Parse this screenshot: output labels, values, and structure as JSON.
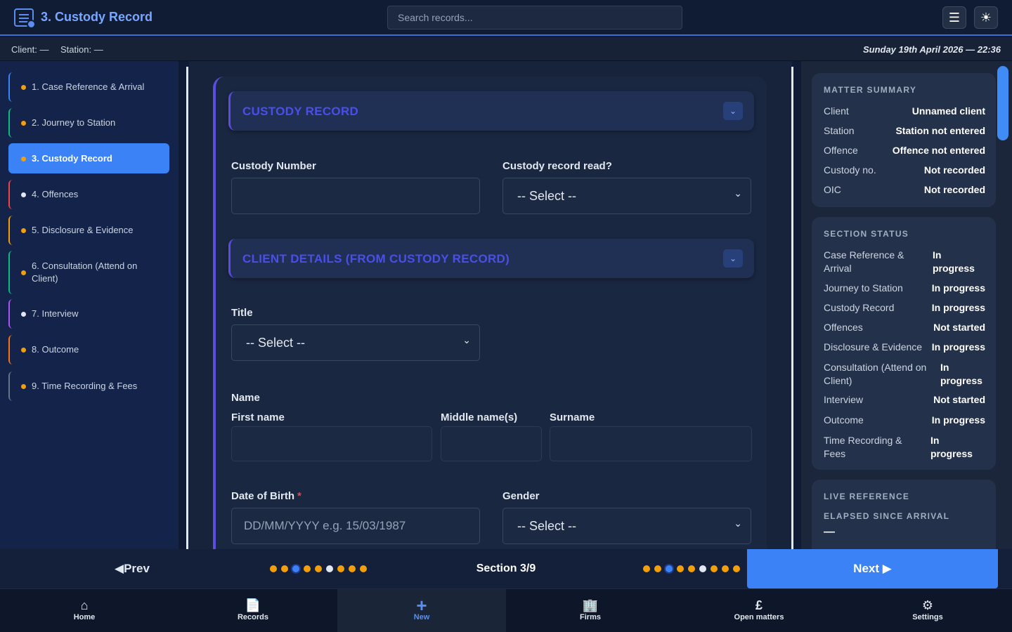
{
  "header": {
    "title": "3. Custody Record",
    "search_placeholder": "Search records...",
    "menu_icon": "hamburger-icon",
    "theme_icon": "sun-icon"
  },
  "subheader": {
    "client": "Client: —",
    "station": "Station: —",
    "datetime": "Sunday 19th April 2026 — 22:36"
  },
  "sidebar": {
    "items": [
      {
        "label": "1. Case Reference & Arrival",
        "color": "#3b82f6",
        "status": "in-progress"
      },
      {
        "label": "2. Journey to Station",
        "color": "#10b981",
        "status": "in-progress"
      },
      {
        "label": "3. Custody Record",
        "color": "#3b82f6",
        "status": "in-progress",
        "active": true
      },
      {
        "label": "4. Offences",
        "color": "#ef4444",
        "status": "not-started"
      },
      {
        "label": "5. Disclosure & Evidence",
        "color": "#f59e0b",
        "status": "in-progress"
      },
      {
        "label": "6. Consultation (Attend on Client)",
        "color": "#10b981",
        "status": "in-progress"
      },
      {
        "label": "7. Interview",
        "color": "#a855f7",
        "status": "not-started"
      },
      {
        "label": "8. Outcome",
        "color": "#f97316",
        "status": "in-progress"
      },
      {
        "label": "9. Time Recording & Fees",
        "color": "#64748b",
        "status": "in-progress"
      }
    ]
  },
  "form": {
    "section1_title": "CUSTODY RECORD",
    "custody_number_label": "Custody Number",
    "custody_number_value": "",
    "custody_read_label": "Custody record read?",
    "custody_read_value": "-- Select --",
    "section2_title": "CLIENT DETAILS (FROM CUSTODY RECORD)",
    "title_label": "Title",
    "title_value": "-- Select --",
    "name_label": "Name",
    "first_name_label": "First name",
    "middle_name_label": "Middle name(s)",
    "surname_label": "Surname",
    "dob_label": "Date of Birth",
    "dob_required": "*",
    "dob_placeholder": "DD/MM/YYYY e.g. 15/03/1987",
    "gender_label": "Gender",
    "gender_value": "-- Select --"
  },
  "matter_summary": {
    "title": "MATTER SUMMARY",
    "rows": [
      {
        "key": "Client",
        "value": "Unnamed client"
      },
      {
        "key": "Station",
        "value": "Station not entered"
      },
      {
        "key": "Offence",
        "value": "Offence not entered"
      },
      {
        "key": "Custody no.",
        "value": "Not recorded"
      },
      {
        "key": "OIC",
        "value": "Not recorded"
      }
    ]
  },
  "section_status": {
    "title": "SECTION STATUS",
    "rows": [
      {
        "key": "Case Reference & Arrival",
        "value": "In progress"
      },
      {
        "key": "Journey to Station",
        "value": "In progress"
      },
      {
        "key": "Custody Record",
        "value": "In progress"
      },
      {
        "key": "Offences",
        "value": "Not started"
      },
      {
        "key": "Disclosure & Evidence",
        "value": "In progress"
      },
      {
        "key": "Consultation (Attend on Client)",
        "value": "In progress"
      },
      {
        "key": "Interview",
        "value": "Not started"
      },
      {
        "key": "Outcome",
        "value": "In progress"
      },
      {
        "key": "Time Recording & Fees",
        "value": "In progress"
      }
    ]
  },
  "live_reference": {
    "title": "LIVE REFERENCE",
    "elapsed_label": "ELAPSED SINCE ARRIVAL",
    "elapsed_value": "—"
  },
  "pager": {
    "prev_label": "Prev",
    "next_label": "Next",
    "section_label": "Section 3/9",
    "current": 3,
    "total": 9,
    "dot_colors": [
      "#f59e0b",
      "#f59e0b",
      "#3b82f6",
      "#f59e0b",
      "#f59e0b",
      "#e2e8f0",
      "#f59e0b",
      "#f59e0b",
      "#f59e0b"
    ]
  },
  "tabbar": {
    "tabs": [
      {
        "label": "Home",
        "icon": "home-icon"
      },
      {
        "label": "Records",
        "icon": "document-icon"
      },
      {
        "label": "New",
        "icon": "plus-icon",
        "active": true
      },
      {
        "label": "Firms",
        "icon": "building-icon"
      },
      {
        "label": "Open matters",
        "icon": "pound-icon"
      },
      {
        "label": "Settings",
        "icon": "gear-icon"
      }
    ]
  }
}
